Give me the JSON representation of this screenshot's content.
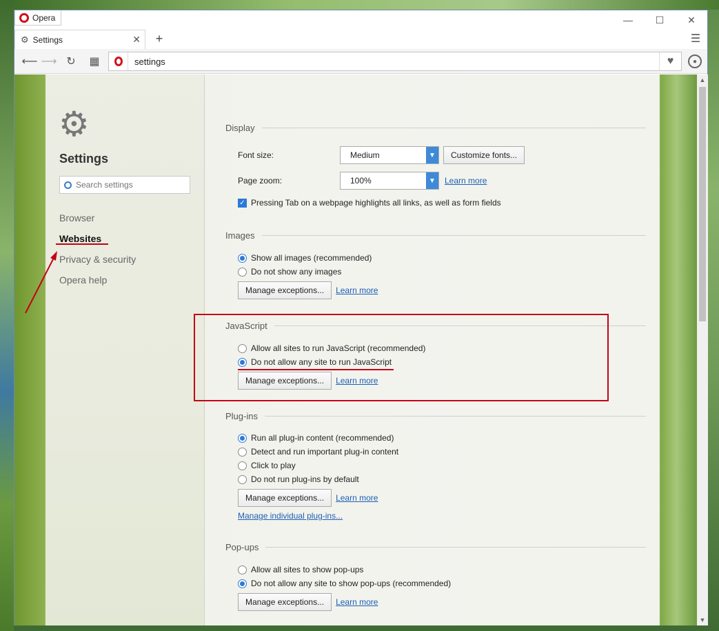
{
  "window": {
    "app_label": "Opera",
    "controls": [
      "—",
      "☐",
      "✕"
    ]
  },
  "tab": {
    "title": "Settings",
    "close": "✕",
    "new_tab": "+"
  },
  "toolbar": {
    "address": "settings"
  },
  "sidebar": {
    "title": "Settings",
    "search_placeholder": "Search settings",
    "items": [
      {
        "label": "Browser",
        "active": false
      },
      {
        "label": "Websites",
        "active": true
      },
      {
        "label": "Privacy & security",
        "active": false
      },
      {
        "label": "Opera help",
        "active": false
      }
    ]
  },
  "display": {
    "title": "Display",
    "font_size_label": "Font size:",
    "font_size_value": "Medium",
    "customize_fonts": "Customize fonts...",
    "page_zoom_label": "Page zoom:",
    "page_zoom_value": "100%",
    "learn_more": "Learn more",
    "tab_highlight": "Pressing Tab on a webpage highlights all links, as well as form fields"
  },
  "images": {
    "title": "Images",
    "options": [
      "Show all images (recommended)",
      "Do not show any images"
    ],
    "selected": 0,
    "manage": "Manage exceptions...",
    "learn_more": "Learn more"
  },
  "javascript": {
    "title": "JavaScript",
    "options": [
      "Allow all sites to run JavaScript (recommended)",
      "Do not allow any site to run JavaScript"
    ],
    "selected": 1,
    "manage": "Manage exceptions...",
    "learn_more": "Learn more"
  },
  "plugins": {
    "title": "Plug-ins",
    "options": [
      "Run all plug-in content (recommended)",
      "Detect and run important plug-in content",
      "Click to play",
      "Do not run plug-ins by default"
    ],
    "selected": 0,
    "manage": "Manage exceptions...",
    "learn_more": "Learn more",
    "manage_individual": "Manage individual plug-ins..."
  },
  "popups": {
    "title": "Pop-ups",
    "options": [
      "Allow all sites to show pop-ups",
      "Do not allow any site to show pop-ups (recommended)"
    ],
    "selected": 1,
    "manage": "Manage exceptions...",
    "learn_more": "Learn more"
  },
  "colors": {
    "accent": "#2b7ad8",
    "annotation": "#c40016",
    "opera_red": "#d0111b"
  }
}
